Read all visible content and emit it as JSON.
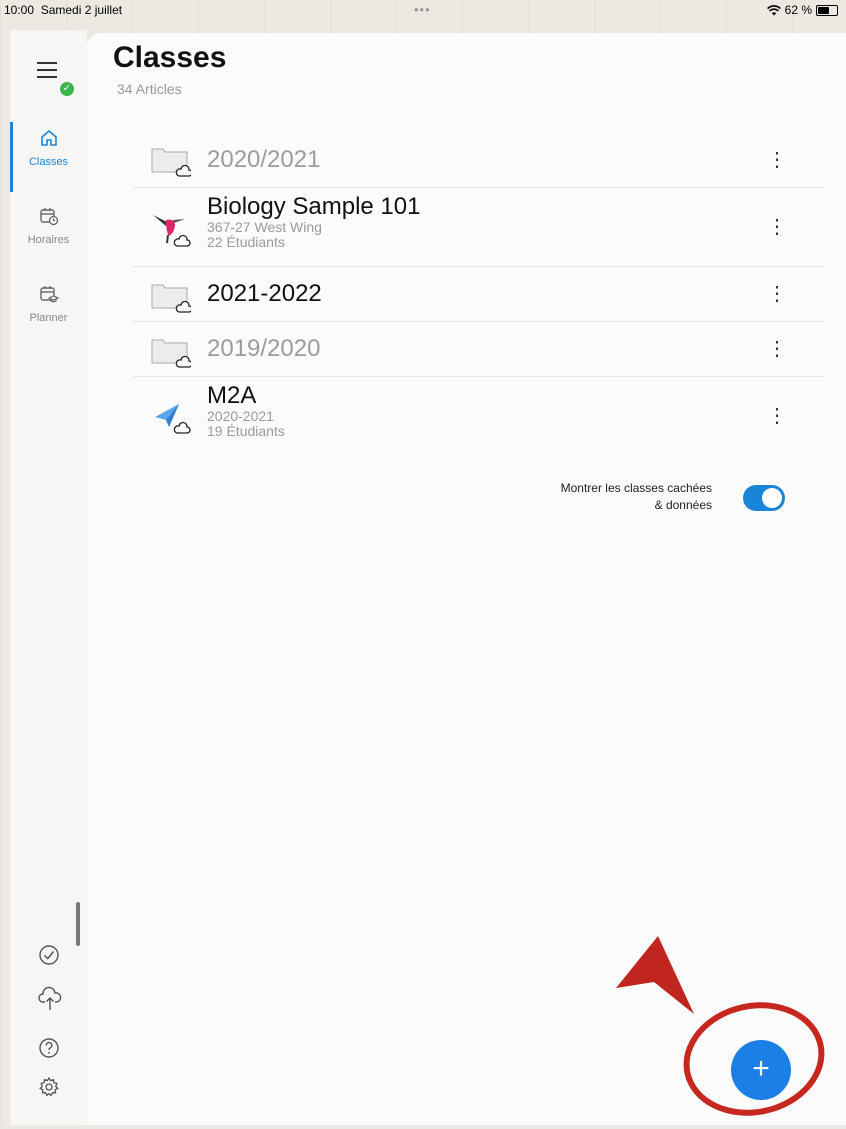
{
  "status": {
    "time": "10:00",
    "date": "Samedi 2 juillet",
    "dots": "•••",
    "battery": "62 %"
  },
  "sidebar": {
    "items": [
      {
        "label": "Classes",
        "icon": "home-icon",
        "active": true
      },
      {
        "label": "Horaires",
        "icon": "calendar-clock-icon",
        "active": false
      },
      {
        "label": "Planner",
        "icon": "calendar-grad-icon",
        "active": false
      }
    ],
    "bottom_icons": [
      "checkmark-circle-icon",
      "cloud-upload-icon",
      "help-icon",
      "settings-icon"
    ]
  },
  "main": {
    "title": "Classes",
    "subtitle": "34 Articles",
    "rows": [
      {
        "type": "folder",
        "title": "2020/2021",
        "grey": true
      },
      {
        "type": "class",
        "title": "Biology Sample 101",
        "sub1": "367-27 West Wing",
        "sub2": "22 Étudiants",
        "icon": "hummingbird-icon"
      },
      {
        "type": "folder",
        "title": "2021-2022",
        "grey": false
      },
      {
        "type": "folder",
        "title": "2019/2020",
        "grey": true
      },
      {
        "type": "class",
        "title": "M2A",
        "sub1": "2020-2021",
        "sub2": "19 Étudiants",
        "icon": "paper-plane-icon"
      }
    ],
    "more_glyph": "⋮",
    "toggle_label_line1": "Montrer les classes cachées",
    "toggle_label_line2": "& données",
    "toggle_on": true,
    "fab": "+"
  },
  "colors": {
    "accent": "#1a84d8",
    "fab": "#1b7fe6",
    "annotation": "#c62820"
  }
}
